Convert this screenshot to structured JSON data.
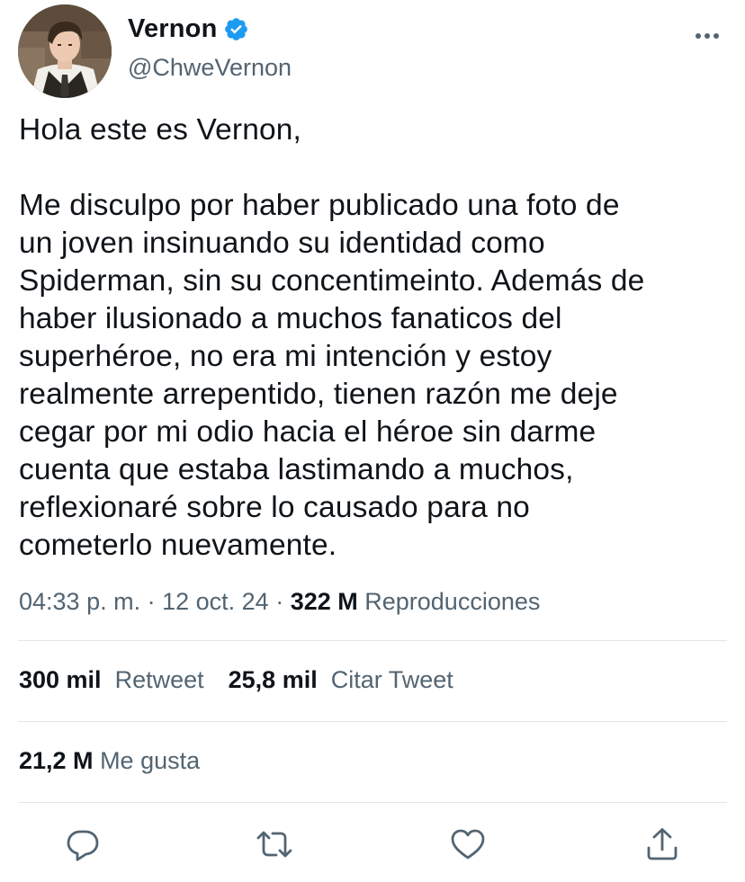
{
  "author": {
    "display_name": "Vernon",
    "handle": "@ChweVernon",
    "verified": true,
    "avatar_icon": "profile-photo"
  },
  "tweet": {
    "lines": [
      "Hola este es Vernon,",
      "",
      "Me disculpo por haber publicado una foto de",
      "un joven insinuando su identidad como",
      "Spiderman, sin su concentimeinto. Además de",
      "haber ilusionado a muchos fanaticos del",
      "superhéroe, no era mi intención y estoy",
      "realmente arrepentido, tienen razón me deje",
      "cegar por mi odio hacia el héroe sin darme",
      "cuenta que estaba lastimando a muchos,",
      "reflexionaré sobre lo causado para no",
      "cometerlo nuevamente."
    ]
  },
  "meta": {
    "time": "04:33 p. m.",
    "sep1": " · ",
    "date": "12 oct. 24",
    "sep2": " · ",
    "views_count": "322 M",
    "views_label": "Reproducciones"
  },
  "stats": {
    "retweets_count": "300 mil",
    "retweets_label": "Retweet",
    "quotes_count": "25,8 mil",
    "quotes_label": "Citar Tweet",
    "likes_count": "21,2 M",
    "likes_label": "Me gusta"
  },
  "actions": [
    "reply-icon",
    "retweet-icon",
    "like-icon",
    "share-icon"
  ],
  "colors": {
    "verified": "#1d9bf0",
    "primary_text": "#0f1419",
    "secondary_text": "#536471",
    "divider": "#e1e6ea"
  }
}
